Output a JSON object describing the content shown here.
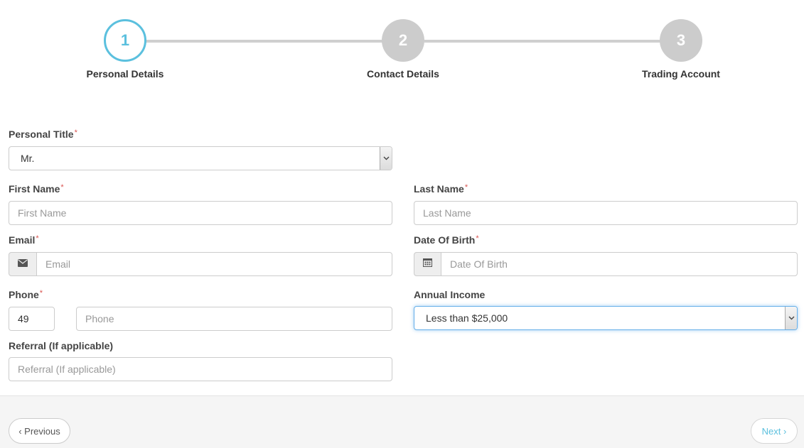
{
  "stepper": {
    "steps": [
      {
        "number": "1",
        "label": "Personal Details",
        "active": true
      },
      {
        "number": "2",
        "label": "Contact Details",
        "active": false
      },
      {
        "number": "3",
        "label": "Trading Account",
        "active": false
      }
    ]
  },
  "form": {
    "personal_title": {
      "label": "Personal Title",
      "required": "*",
      "value": "Mr."
    },
    "first_name": {
      "label": "First Name",
      "required": "*",
      "placeholder": "First Name"
    },
    "last_name": {
      "label": "Last Name",
      "required": "*",
      "placeholder": "Last Name"
    },
    "email": {
      "label": "Email",
      "required": "*",
      "placeholder": "Email",
      "icon": "envelope-icon"
    },
    "date_of_birth": {
      "label": "Date Of Birth",
      "required": "*",
      "placeholder": "Date Of Birth",
      "icon": "calendar-icon"
    },
    "phone": {
      "label": "Phone",
      "required": "*",
      "country_code": "49",
      "placeholder": "Phone"
    },
    "annual_income": {
      "label": "Annual Income",
      "value": "Less than $25,000"
    },
    "referral": {
      "label": "Referral (If applicable)",
      "placeholder": "Referral (If applicable)"
    }
  },
  "footer": {
    "previous_label": "‹ Previous",
    "next_label": "Next ›"
  },
  "colors": {
    "accent": "#5bc0de",
    "inactive_step": "#cccccc",
    "required": "#d9534f"
  }
}
